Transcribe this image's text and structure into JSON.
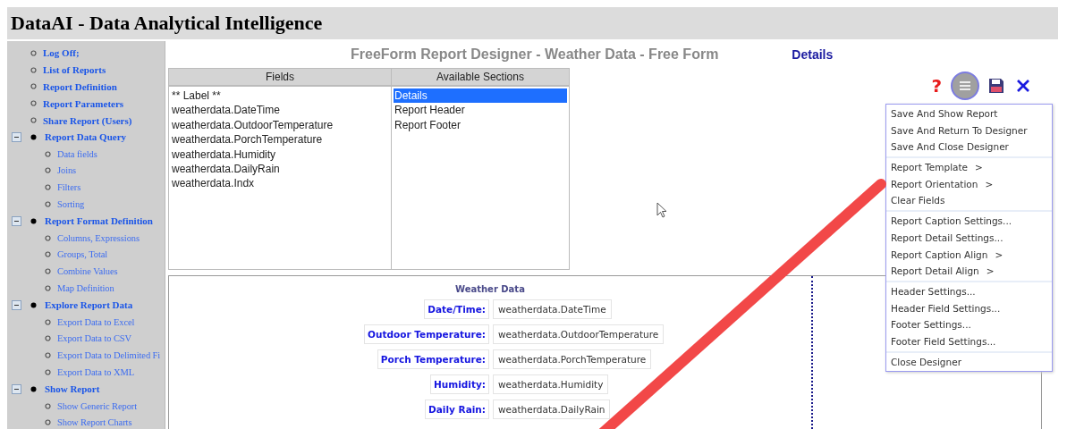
{
  "app": {
    "title": "DataAI - Data Analytical Intelligence"
  },
  "sidebar": {
    "items": [
      {
        "kind": "link",
        "label": "Log Off;"
      },
      {
        "kind": "link",
        "label": "List of Reports"
      },
      {
        "kind": "link",
        "label": "Report Definition"
      },
      {
        "kind": "link",
        "label": "Report Parameters"
      },
      {
        "kind": "link",
        "label": "Share Report (Users)"
      },
      {
        "kind": "group",
        "label": "Report Data Query",
        "expanded": true,
        "children": [
          {
            "label": "Data fields"
          },
          {
            "label": "Joins"
          },
          {
            "label": "Filters"
          },
          {
            "label": "Sorting"
          }
        ]
      },
      {
        "kind": "group",
        "label": "Report Format Definition",
        "expanded": true,
        "children": [
          {
            "label": "Columns, Expressions"
          },
          {
            "label": "Groups, Total"
          },
          {
            "label": "Combine Values"
          },
          {
            "label": "Map Definition"
          }
        ]
      },
      {
        "kind": "group",
        "label": "Explore Report Data",
        "expanded": true,
        "children": [
          {
            "label": "Export Data to Excel"
          },
          {
            "label": "Export Data to CSV"
          },
          {
            "label": "Export Data to Delimited Fi"
          },
          {
            "label": "Export Data to XML"
          }
        ]
      },
      {
        "kind": "group",
        "label": "Show Report",
        "expanded": true,
        "children": [
          {
            "label": "Show Generic Report"
          },
          {
            "label": "Show Report Charts"
          }
        ]
      }
    ]
  },
  "designer": {
    "title": "FreeForm Report Designer - Weather Data - Free Form",
    "section_label": "Details",
    "fields": {
      "heading": "Fields",
      "items": [
        "** Label **",
        "weatherdata.DateTime",
        "weatherdata.OutdoorTemperature",
        "weatherdata.PorchTemperature",
        "weatherdata.Humidity",
        "weatherdata.DailyRain",
        "weatherdata.Indx"
      ]
    },
    "sections": {
      "heading": "Available Sections",
      "items": [
        {
          "label": "Details",
          "selected": true
        },
        {
          "label": "Report Header",
          "selected": false
        },
        {
          "label": "Report Footer",
          "selected": false
        }
      ]
    },
    "toolbar": [
      {
        "kind": "help",
        "label": "?"
      },
      {
        "kind": "menu"
      },
      {
        "kind": "save"
      },
      {
        "kind": "close"
      }
    ],
    "menu": {
      "groups": [
        [
          {
            "label": "Save And Show Report"
          },
          {
            "label": "Save And Return To Designer"
          },
          {
            "label": "Save And Close Designer"
          }
        ],
        [
          {
            "label": "Report Template",
            "arrow": ">"
          },
          {
            "label": "Report Orientation",
            "arrow": ">"
          },
          {
            "label": "Clear Fields"
          }
        ],
        [
          {
            "label": "Report Caption Settings..."
          },
          {
            "label": "Report Detail Settings..."
          },
          {
            "label": "Report Caption Align",
            "arrow": ">"
          },
          {
            "label": "Report Detail Align",
            "arrow": ">"
          }
        ],
        [
          {
            "label": "Header Settings..."
          },
          {
            "label": "Header Field Settings..."
          },
          {
            "label": "Footer Settings..."
          },
          {
            "label": "Footer Field Settings..."
          }
        ],
        [
          {
            "label": "Close Designer"
          }
        ]
      ]
    },
    "canvas": {
      "caption": "Weather Data",
      "rows": [
        {
          "label": "Date/Time:",
          "field": "weatherdata.DateTime"
        },
        {
          "label": "Outdoor Temperature:",
          "field": "weatherdata.OutdoorTemperature"
        },
        {
          "label": "Porch Temperature:",
          "field": "weatherdata.PorchTemperature"
        },
        {
          "label": "Humidity:",
          "field": "weatherdata.Humidity"
        },
        {
          "label": "Daily Rain:",
          "field": "weatherdata.DailyRain"
        }
      ]
    }
  }
}
